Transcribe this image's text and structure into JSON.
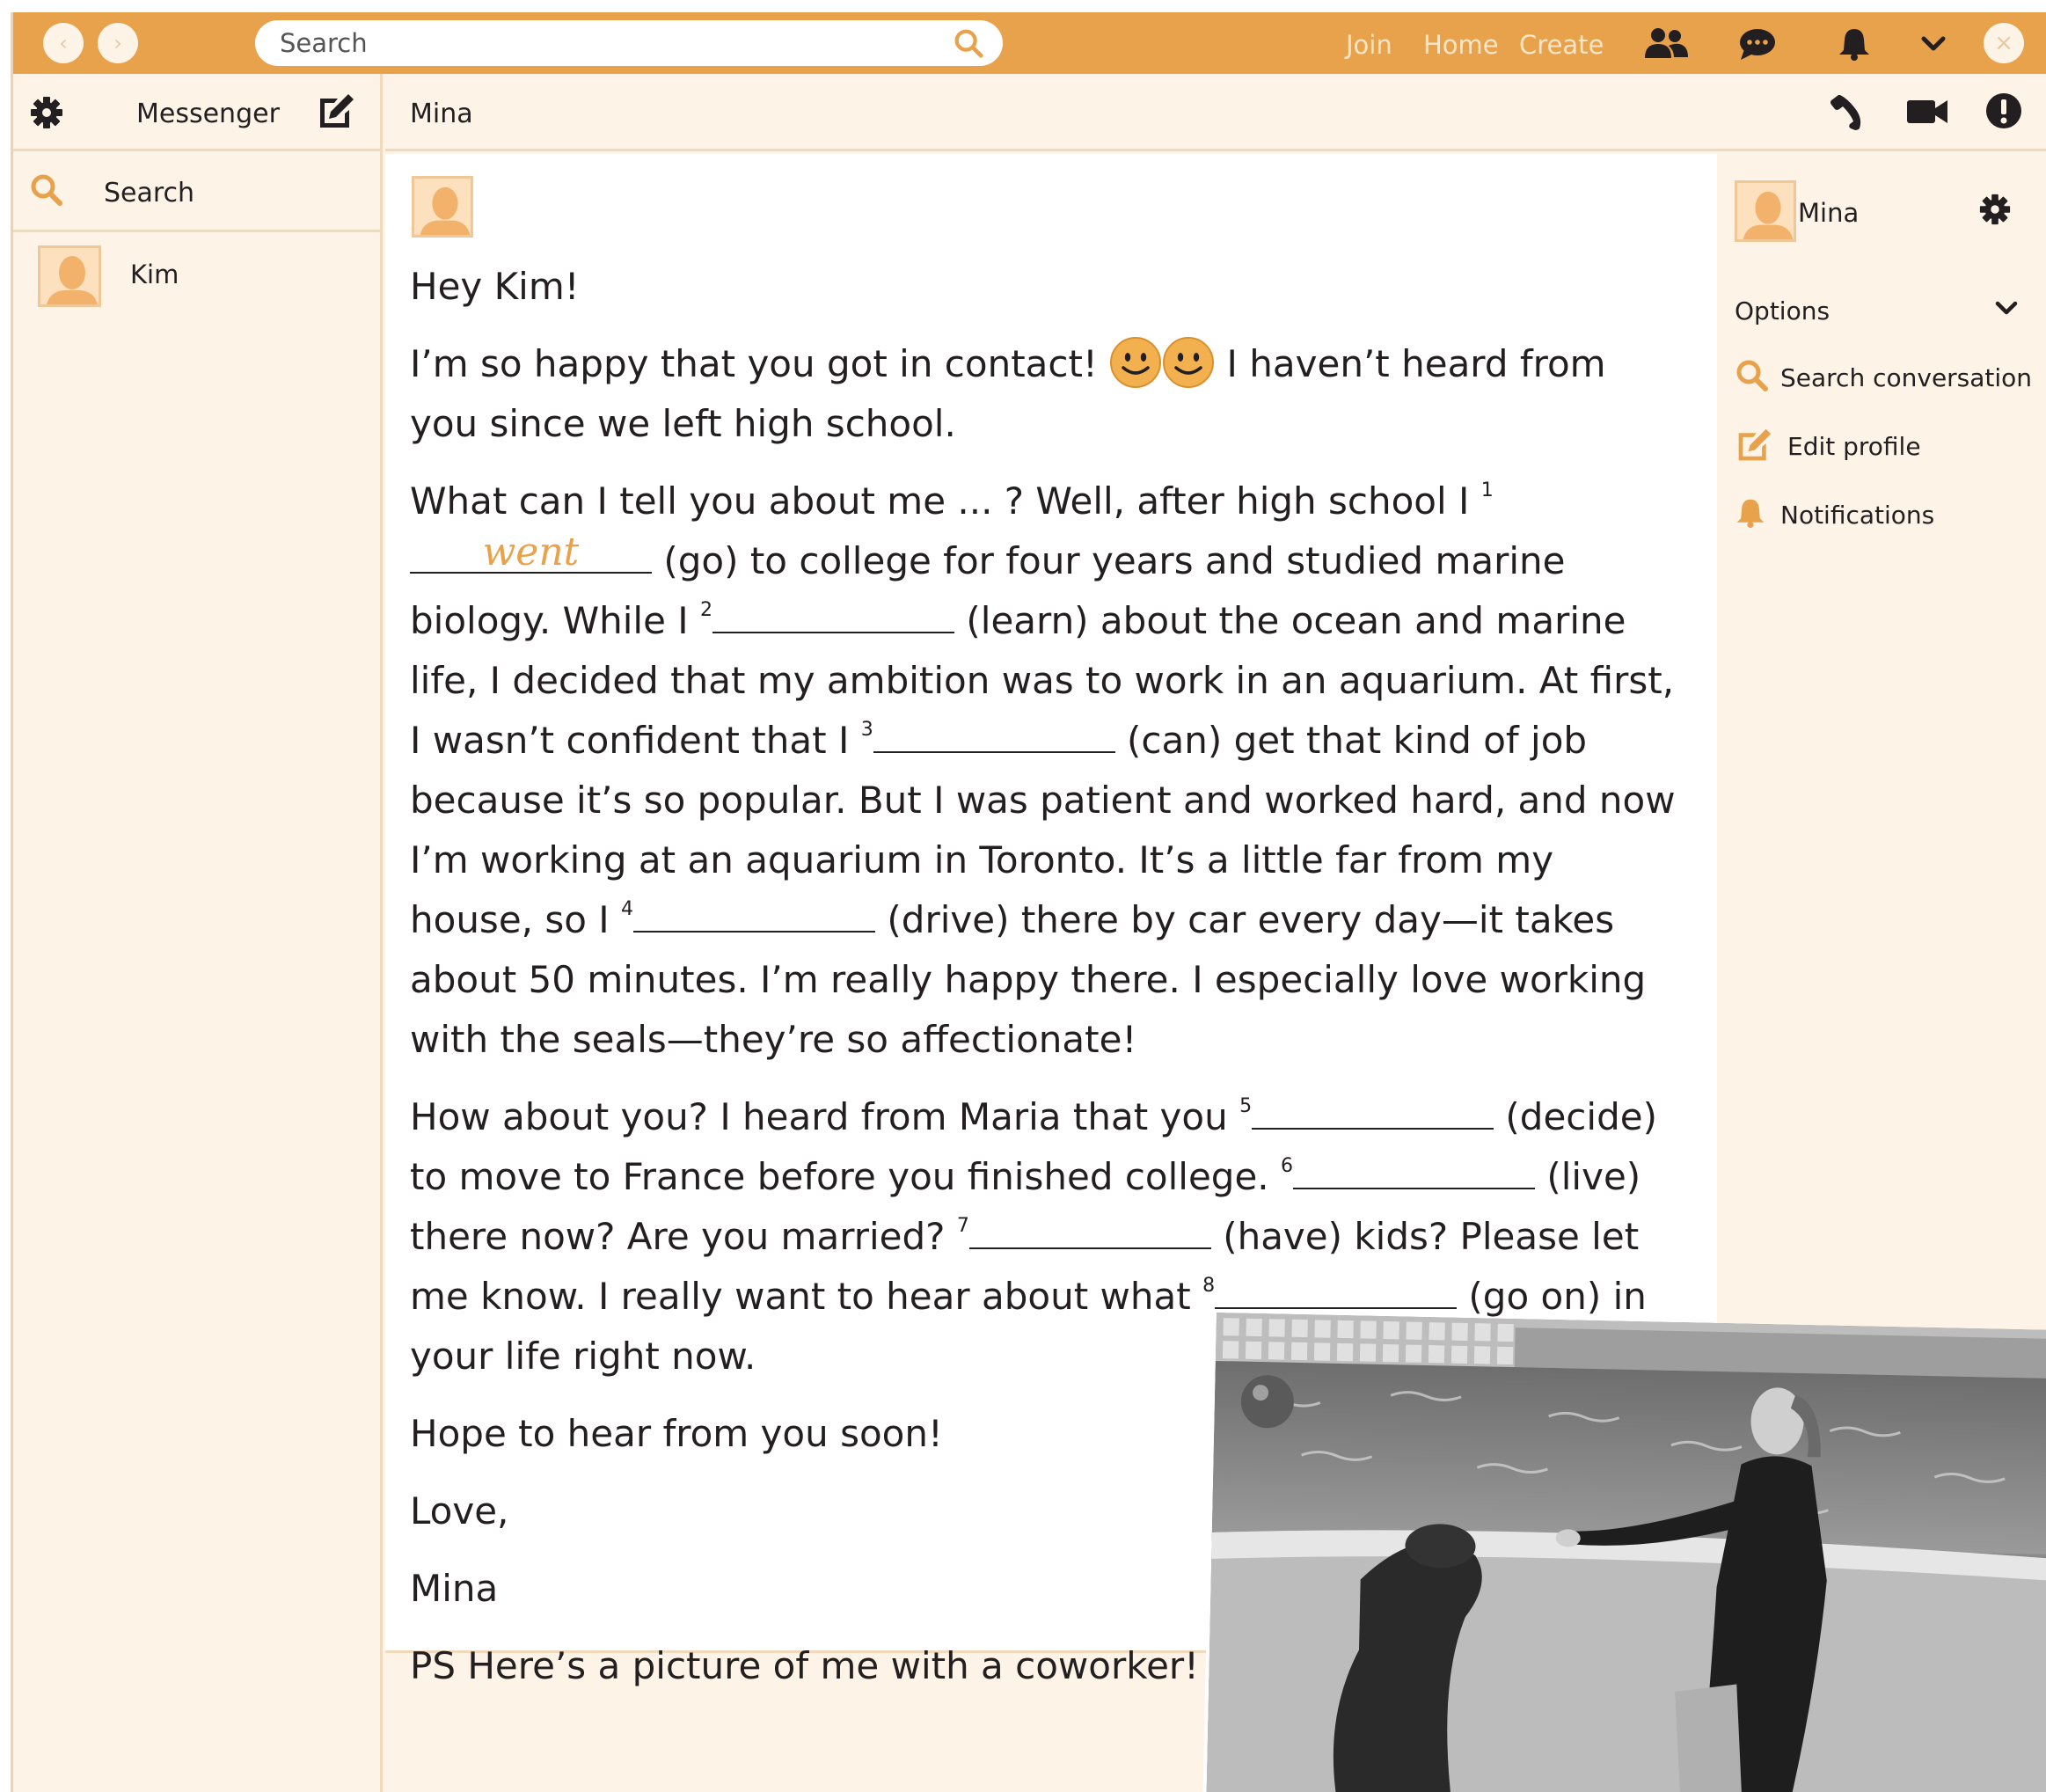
{
  "topbar": {
    "back_glyph": "‹",
    "forward_glyph": "›",
    "search_placeholder": "Search",
    "links": [
      "Join",
      "Home",
      "Create"
    ],
    "close_glyph": "×",
    "icons": [
      "people-icon",
      "chat-bubble-icon",
      "bell-icon",
      "chevron-down-icon"
    ]
  },
  "sidebar": {
    "title": "Messenger",
    "search_label": "Search",
    "contacts": [
      {
        "name": "Kim"
      }
    ]
  },
  "chat": {
    "title": "Mina",
    "icons": [
      "phone-icon",
      "video-camera-icon",
      "alert-icon"
    ]
  },
  "message": {
    "greeting": "Hey Kim!",
    "p1_a": "I’m so happy that you got in contact!",
    "p1_b": "I haven’t heard from you since we left high school.",
    "p2_s1": "What can I tell you about me ... ? Well, after high school I",
    "n1": "1",
    "a1": "went",
    "p2_s2": "(go) to college for four years and studied marine biology. While I",
    "n2": "2",
    "p2_s3": "(learn) about the ocean and marine life, I decided that my ambition was to work in an aquarium. At first, I wasn’t confident that I",
    "n3": "3",
    "p2_s4": "(can) get that kind of job because it’s so popular. But I was patient and worked hard, and now I’m working at an aquarium in Toronto. It’s a little far from my house, so I",
    "n4": "4",
    "p2_s5": "(drive) there by car every day—it takes about 50 minutes. I’m really happy there. I especially love working with the seals—they’re so affectionate!",
    "p3_s1": "How about you? I heard from Maria that you",
    "n5": "5",
    "p3_s2": "(decide) to move to France before you finished college.",
    "n6": "6",
    "p3_s3": "(live) there now? Are you married?",
    "n7": "7",
    "p3_s4": "(have) kids? Please let me know. I really want to hear about what",
    "n8": "8",
    "p3_s5": "(go on) in your life right now.",
    "closing1": "Hope to hear from you soon!",
    "closing2": "Love,",
    "signature": "Mina",
    "ps": "PS Here’s a picture of me with a coworker!"
  },
  "right_panel": {
    "name": "Mina",
    "options_label": "Options",
    "items": [
      {
        "label": "Search conversation",
        "icon": "search-icon"
      },
      {
        "label": "Edit profile",
        "icon": "edit-icon"
      },
      {
        "label": "Notifications",
        "icon": "bell-icon"
      }
    ]
  },
  "colors": {
    "accent": "#e8a24b",
    "panel_bg": "#fdf3e7",
    "border": "#f2d9bb",
    "answer": "#e8a24b"
  }
}
